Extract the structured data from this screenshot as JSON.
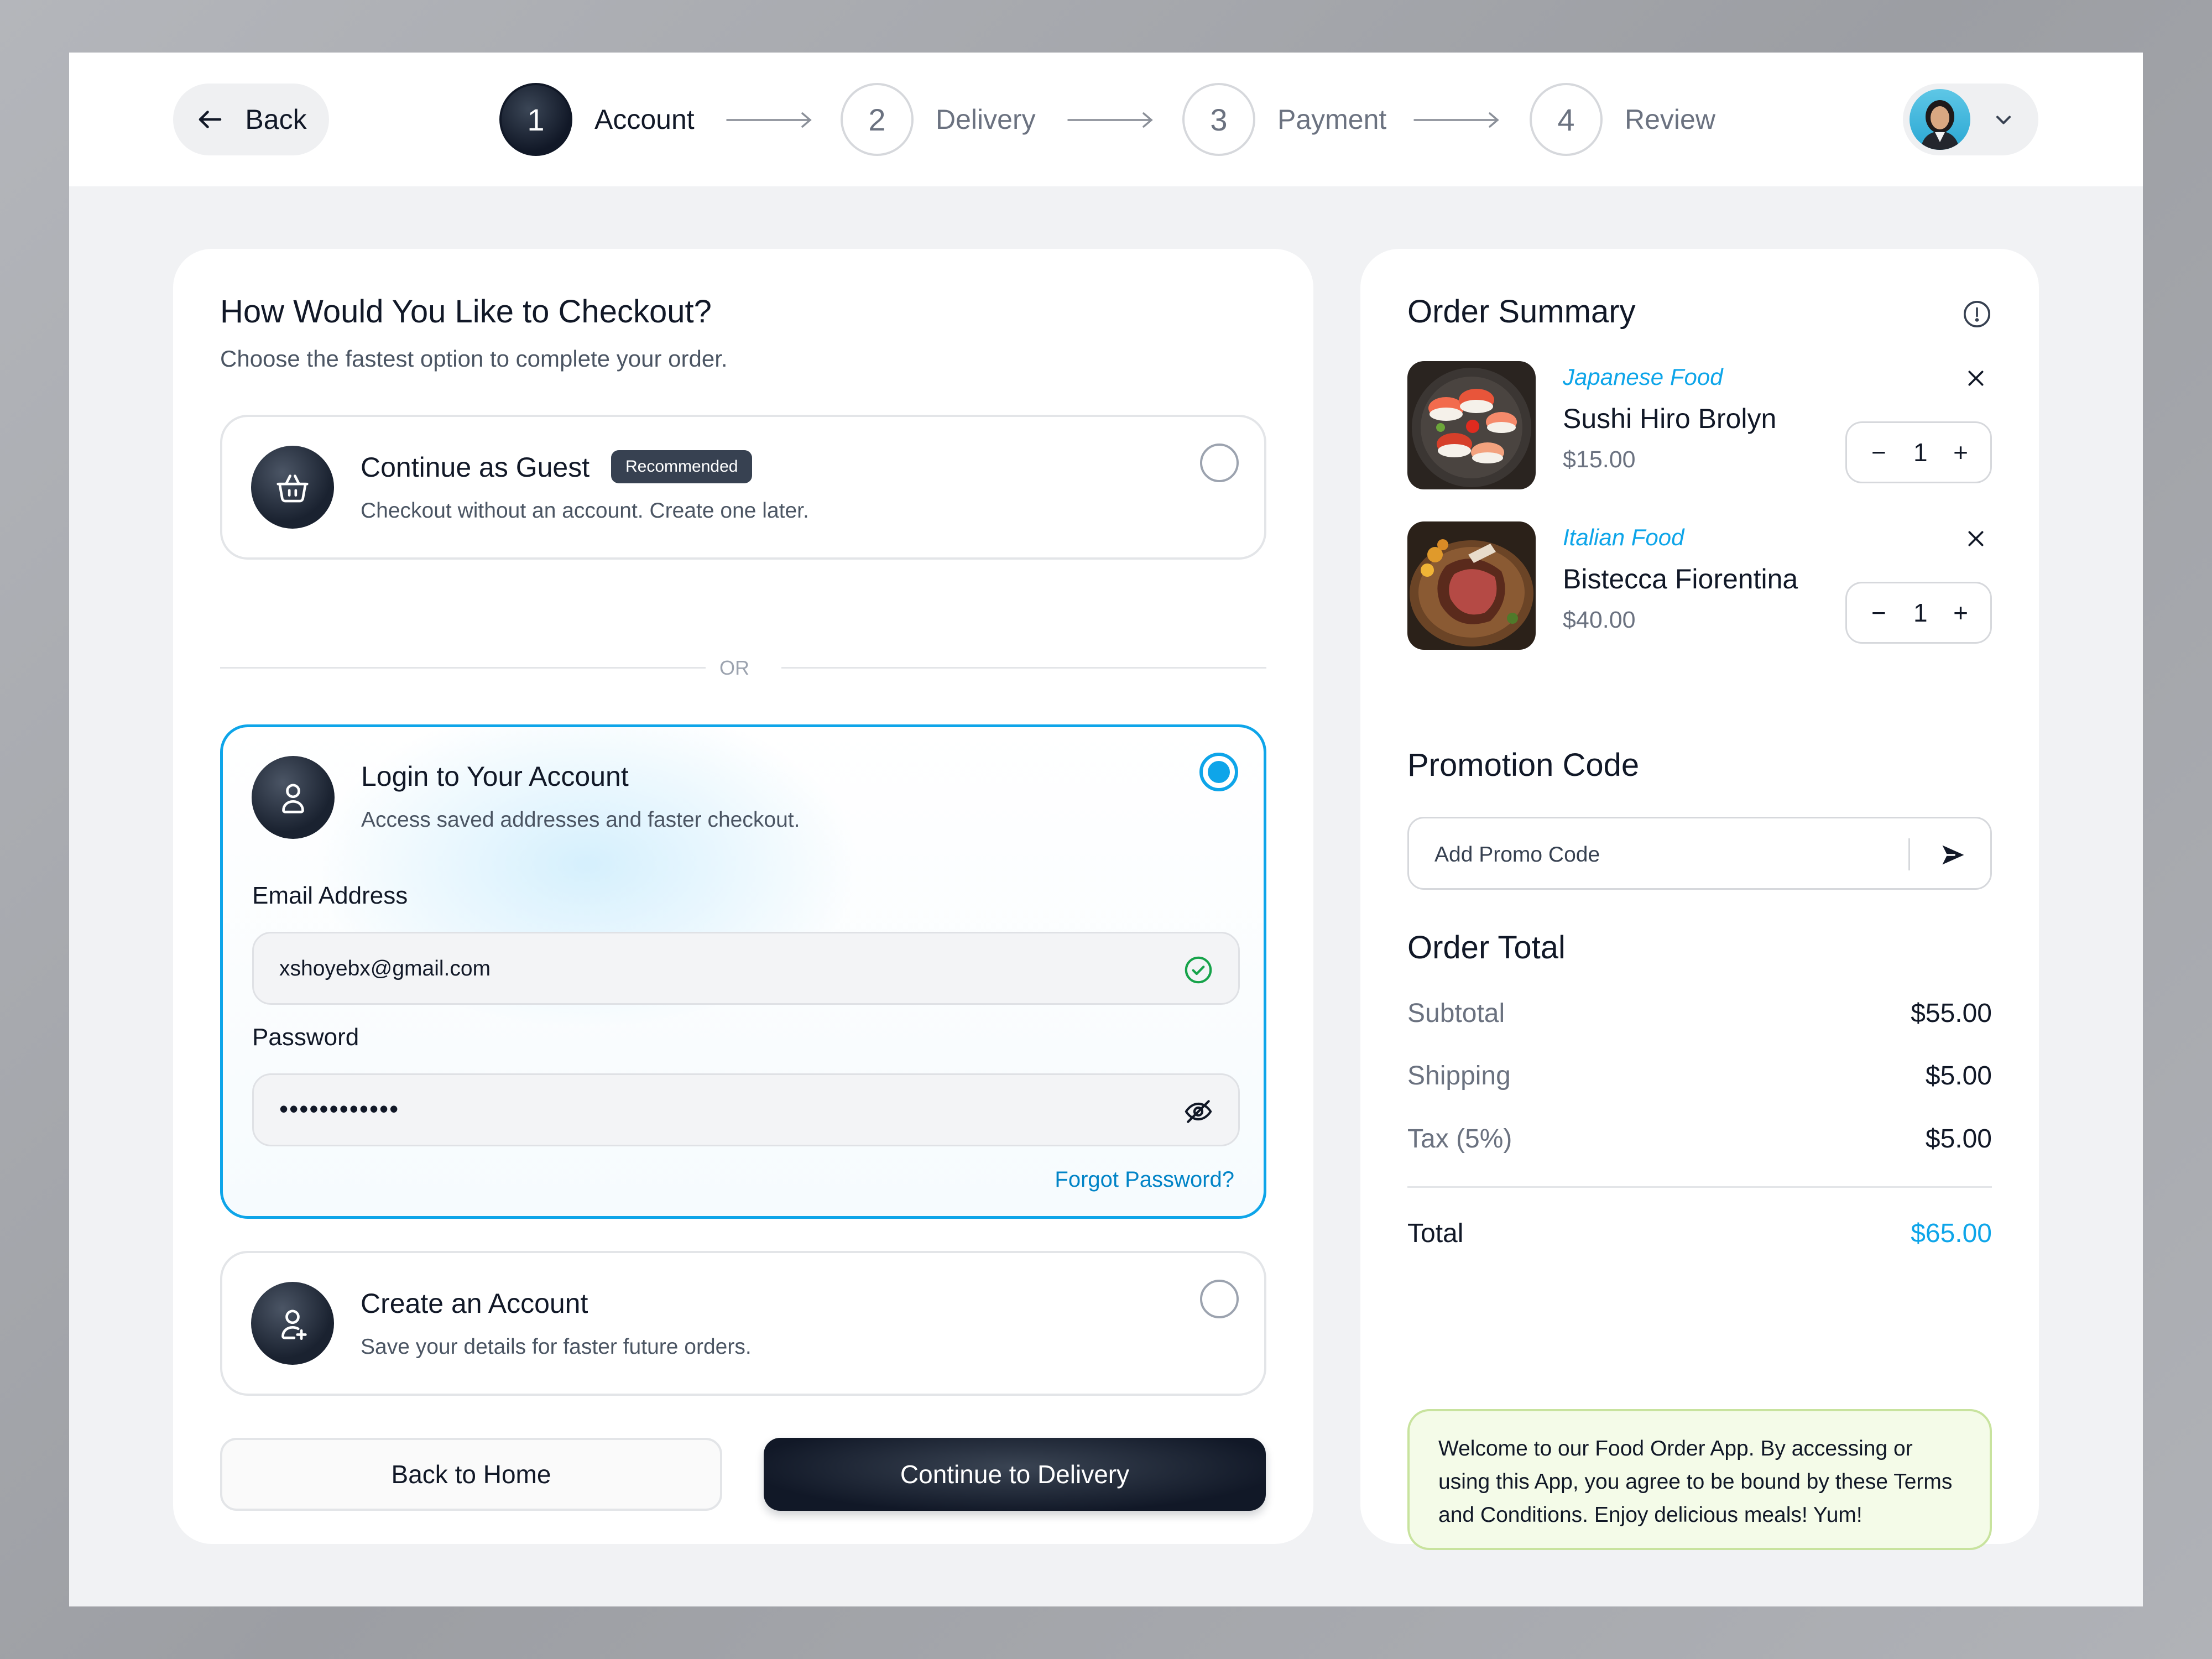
{
  "header": {
    "back_label": "Back",
    "steps": [
      {
        "num": "1",
        "label": "Account",
        "active": true
      },
      {
        "num": "2",
        "label": "Delivery",
        "active": false
      },
      {
        "num": "3",
        "label": "Payment",
        "active": false
      },
      {
        "num": "4",
        "label": "Review",
        "active": false
      }
    ]
  },
  "checkout": {
    "title": "How Would You Like to Checkout?",
    "subtitle": "Choose the fastest option to complete your order.",
    "guest": {
      "title": "Continue as Guest",
      "badge": "Recommended",
      "desc": "Checkout without an account. Create one later.",
      "icon": "basket-icon",
      "selected": false
    },
    "or_label": "OR",
    "login": {
      "title": "Login to Your Account",
      "desc": "Access saved addresses and faster checkout.",
      "icon": "user-icon",
      "selected": true,
      "email_label": "Email Address",
      "email_value": "xshoyebx@gmail.com",
      "password_label": "Password",
      "password_value": "••••••••••••",
      "forgot_label": "Forgot Password?"
    },
    "create": {
      "title": "Create an Account",
      "desc": "Save your details for faster future orders.",
      "icon": "user-add-icon",
      "selected": false
    },
    "back_home_label": "Back to Home",
    "continue_label": "Continue to Delivery"
  },
  "summary": {
    "title": "Order Summary",
    "items": [
      {
        "category": "Japanese Food",
        "name": "Sushi Hiro Brolyn",
        "price": "$15.00",
        "qty": "1"
      },
      {
        "category": "Italian Food",
        "name": "Bistecca Fiorentina",
        "price": "$40.00",
        "qty": "1"
      }
    ],
    "promo_title": "Promotion Code",
    "promo_placeholder": "Add Promo Code",
    "total_title": "Order Total",
    "rows": [
      {
        "label": "Subtotal",
        "value": "$55.00"
      },
      {
        "label": "Shipping",
        "value": "$5.00"
      },
      {
        "label": "Tax (5%)",
        "value": "$5.00"
      }
    ],
    "total_label": "Total",
    "total_value": "$65.00",
    "terms": "Welcome to our Food Order App. By accessing or using this App, you agree to be bound by these Terms and Conditions. Enjoy delicious meals! Yum!"
  },
  "colors": {
    "accent": "#0ea5e9",
    "dark": "#111827",
    "terms_bg": "#f4fbe8"
  }
}
